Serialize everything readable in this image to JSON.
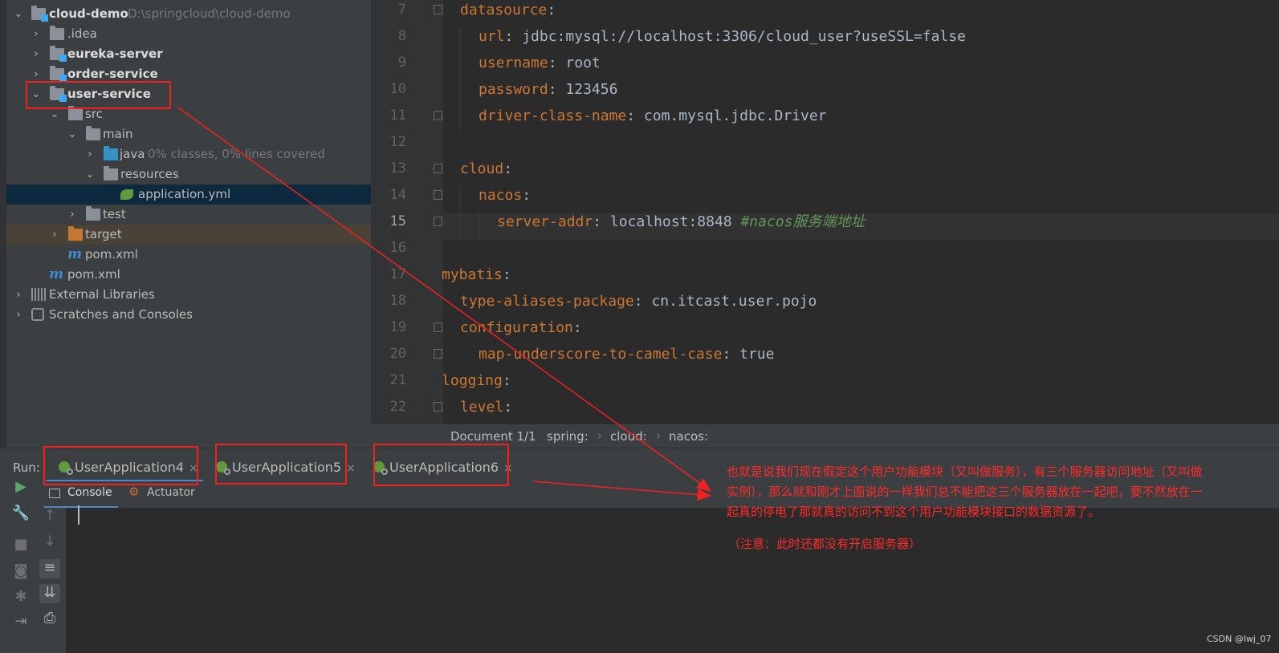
{
  "tree": {
    "root_name": "cloud-demo",
    "root_path": "D:\\springcloud\\cloud-demo",
    "items": [
      {
        "label": ".idea"
      },
      {
        "label": "eureka-server"
      },
      {
        "label": "order-service"
      },
      {
        "label": "user-service"
      },
      {
        "label": "src"
      },
      {
        "label": "main"
      },
      {
        "label": "java",
        "coverage": "0% classes, 0% lines covered"
      },
      {
        "label": "resources"
      },
      {
        "label": "application.yml"
      },
      {
        "label": "test"
      },
      {
        "label": "target"
      },
      {
        "label": "pom.xml"
      },
      {
        "label": "pom.xml"
      },
      {
        "label": "External Libraries"
      },
      {
        "label": "Scratches and Consoles"
      }
    ]
  },
  "editor": {
    "line_numbers": [
      "7",
      "8",
      "9",
      "10",
      "11",
      "12",
      "13",
      "14",
      "15",
      "16",
      "17",
      "18",
      "19",
      "20",
      "21",
      "22"
    ],
    "current_line": "15",
    "lines": [
      {
        "key": "datasource",
        "sep": ":",
        "val": ""
      },
      {
        "key": "url",
        "sep": ": ",
        "val": "jdbc:mysql://localhost:3306/cloud_user?useSSL=false"
      },
      {
        "key": "username",
        "sep": ": ",
        "val": "root"
      },
      {
        "key": "password",
        "sep": ": ",
        "val": "123456"
      },
      {
        "key": "driver-class-name",
        "sep": ": ",
        "val": "com.mysql.jdbc.Driver"
      },
      {
        "key": "",
        "sep": "",
        "val": ""
      },
      {
        "key": "cloud",
        "sep": ":",
        "val": ""
      },
      {
        "key": "nacos",
        "sep": ":",
        "val": ""
      },
      {
        "key": "server-addr",
        "sep": ": ",
        "val": "localhost:8848 ",
        "comment": "#nacos服务端地址"
      },
      {
        "key": "",
        "sep": "",
        "val": ""
      },
      {
        "key": "mybatis",
        "sep": ":",
        "val": ""
      },
      {
        "key": "type-aliases-package",
        "sep": ": ",
        "val": "cn.itcast.user.pojo"
      },
      {
        "key": "configuration",
        "sep": ":",
        "val": ""
      },
      {
        "key": "map-underscore-to-camel-case",
        "sep": ": ",
        "val": "true"
      },
      {
        "key": "logging",
        "sep": ":",
        "val": ""
      },
      {
        "key": "level",
        "sep": ":",
        "val": ""
      }
    ]
  },
  "breadcrumb": {
    "document": "Document 1/1",
    "items": [
      "spring:",
      "cloud:",
      "nacos:"
    ]
  },
  "run": {
    "label": "Run:",
    "tabs": [
      "UserApplication4",
      "UserApplication5",
      "UserApplication6"
    ],
    "close_glyph": "×",
    "subtabs": [
      "Console",
      "Actuator"
    ]
  },
  "annotation": {
    "line1": "也就是说我们现在假定这个用户功能模块（又叫做服务），有三个服务器访问地址（又叫做",
    "line2": "实例），那么就和刚才上面说的一样我们总不能把这三个服务器放在一起吧，要不然放在一",
    "line3": "起真的停电了那就真的访问不到这个用户功能模块接口的数据资源了。",
    "note": "（注意：此时还都没有开启服务器）"
  },
  "watermark": "CSDN @lwj_07",
  "colors": {
    "keyword": "#cc7832",
    "value": "#a9b7c6",
    "comment": "#629755",
    "annotation": "#ff2a2a",
    "selection": "#0d293e"
  },
  "icons": [
    "folder-icon",
    "module-icon",
    "spring-yml-icon",
    "maven-icon",
    "libraries-icon",
    "scratches-icon",
    "run-icon",
    "wrench-icon",
    "stop-icon",
    "camera-icon",
    "bug-icon",
    "exit-icon",
    "up-arrow-icon",
    "down-arrow-icon",
    "wrap-icon",
    "scroll-end-icon",
    "print-icon"
  ]
}
